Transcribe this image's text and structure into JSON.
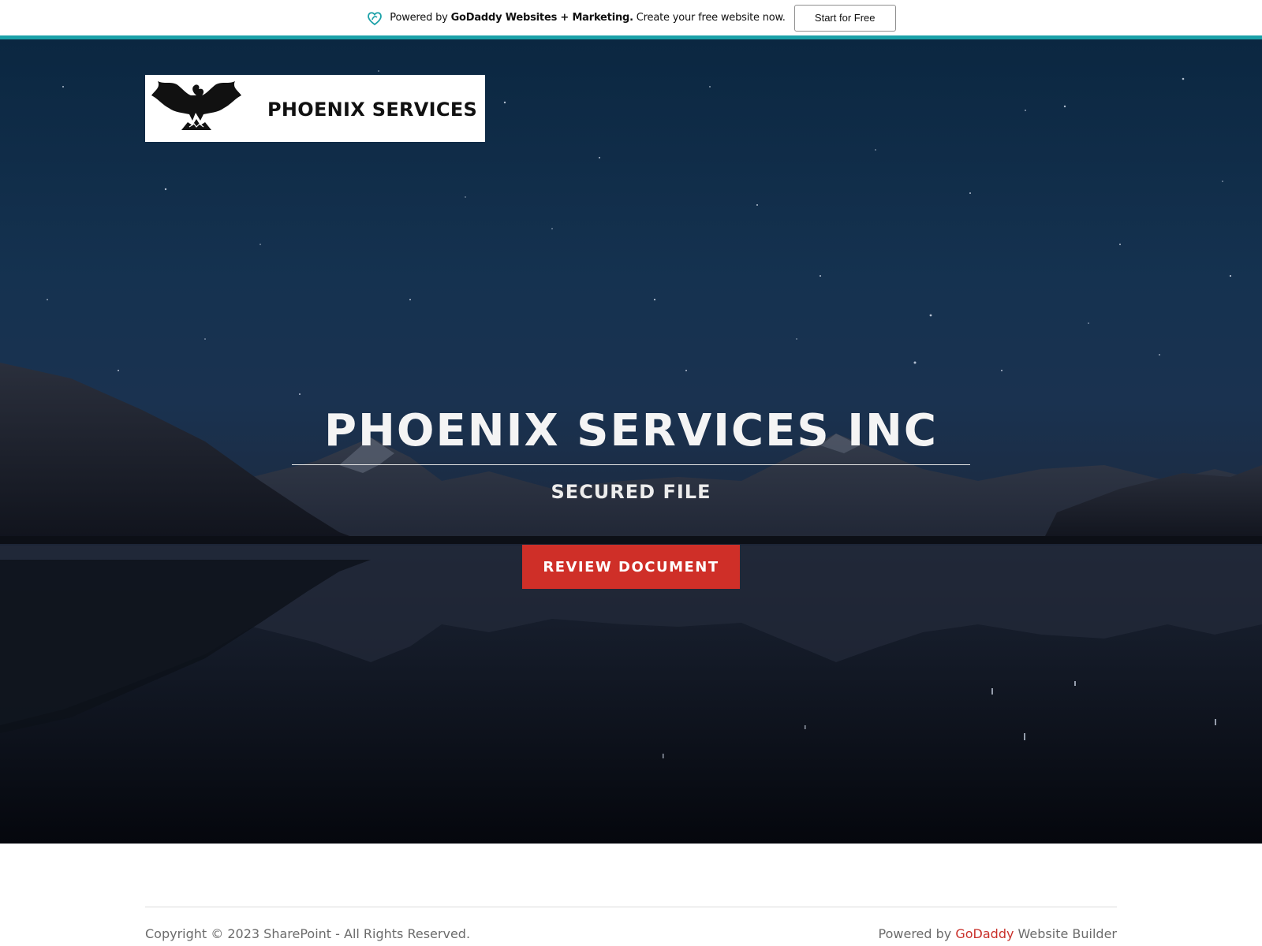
{
  "promo": {
    "powered_prefix": "Powered by",
    "brand_bold": "GoDaddy Websites + Marketing.",
    "tagline": "Create your free website now.",
    "cta_label": "Start for Free",
    "logo_icon": "godaddy-heart-icon",
    "accent_color": "#1ba1a8"
  },
  "header": {
    "logo_text": "PHOENIX SERVICES",
    "logo_icon": "phoenix-bird-icon"
  },
  "hero": {
    "title": "PHOENIX SERVICES INC",
    "subtitle": "SECURED FILE",
    "cta_label": "REVIEW DOCUMENT",
    "cta_color": "#cf2f28"
  },
  "footer": {
    "copyright": "Copyright © 2023 SharePoint - All Rights Reserved.",
    "powered_prefix": "Powered by",
    "powered_link": "GoDaddy",
    "powered_suffix": "Website Builder",
    "link_color": "#c9302a"
  }
}
